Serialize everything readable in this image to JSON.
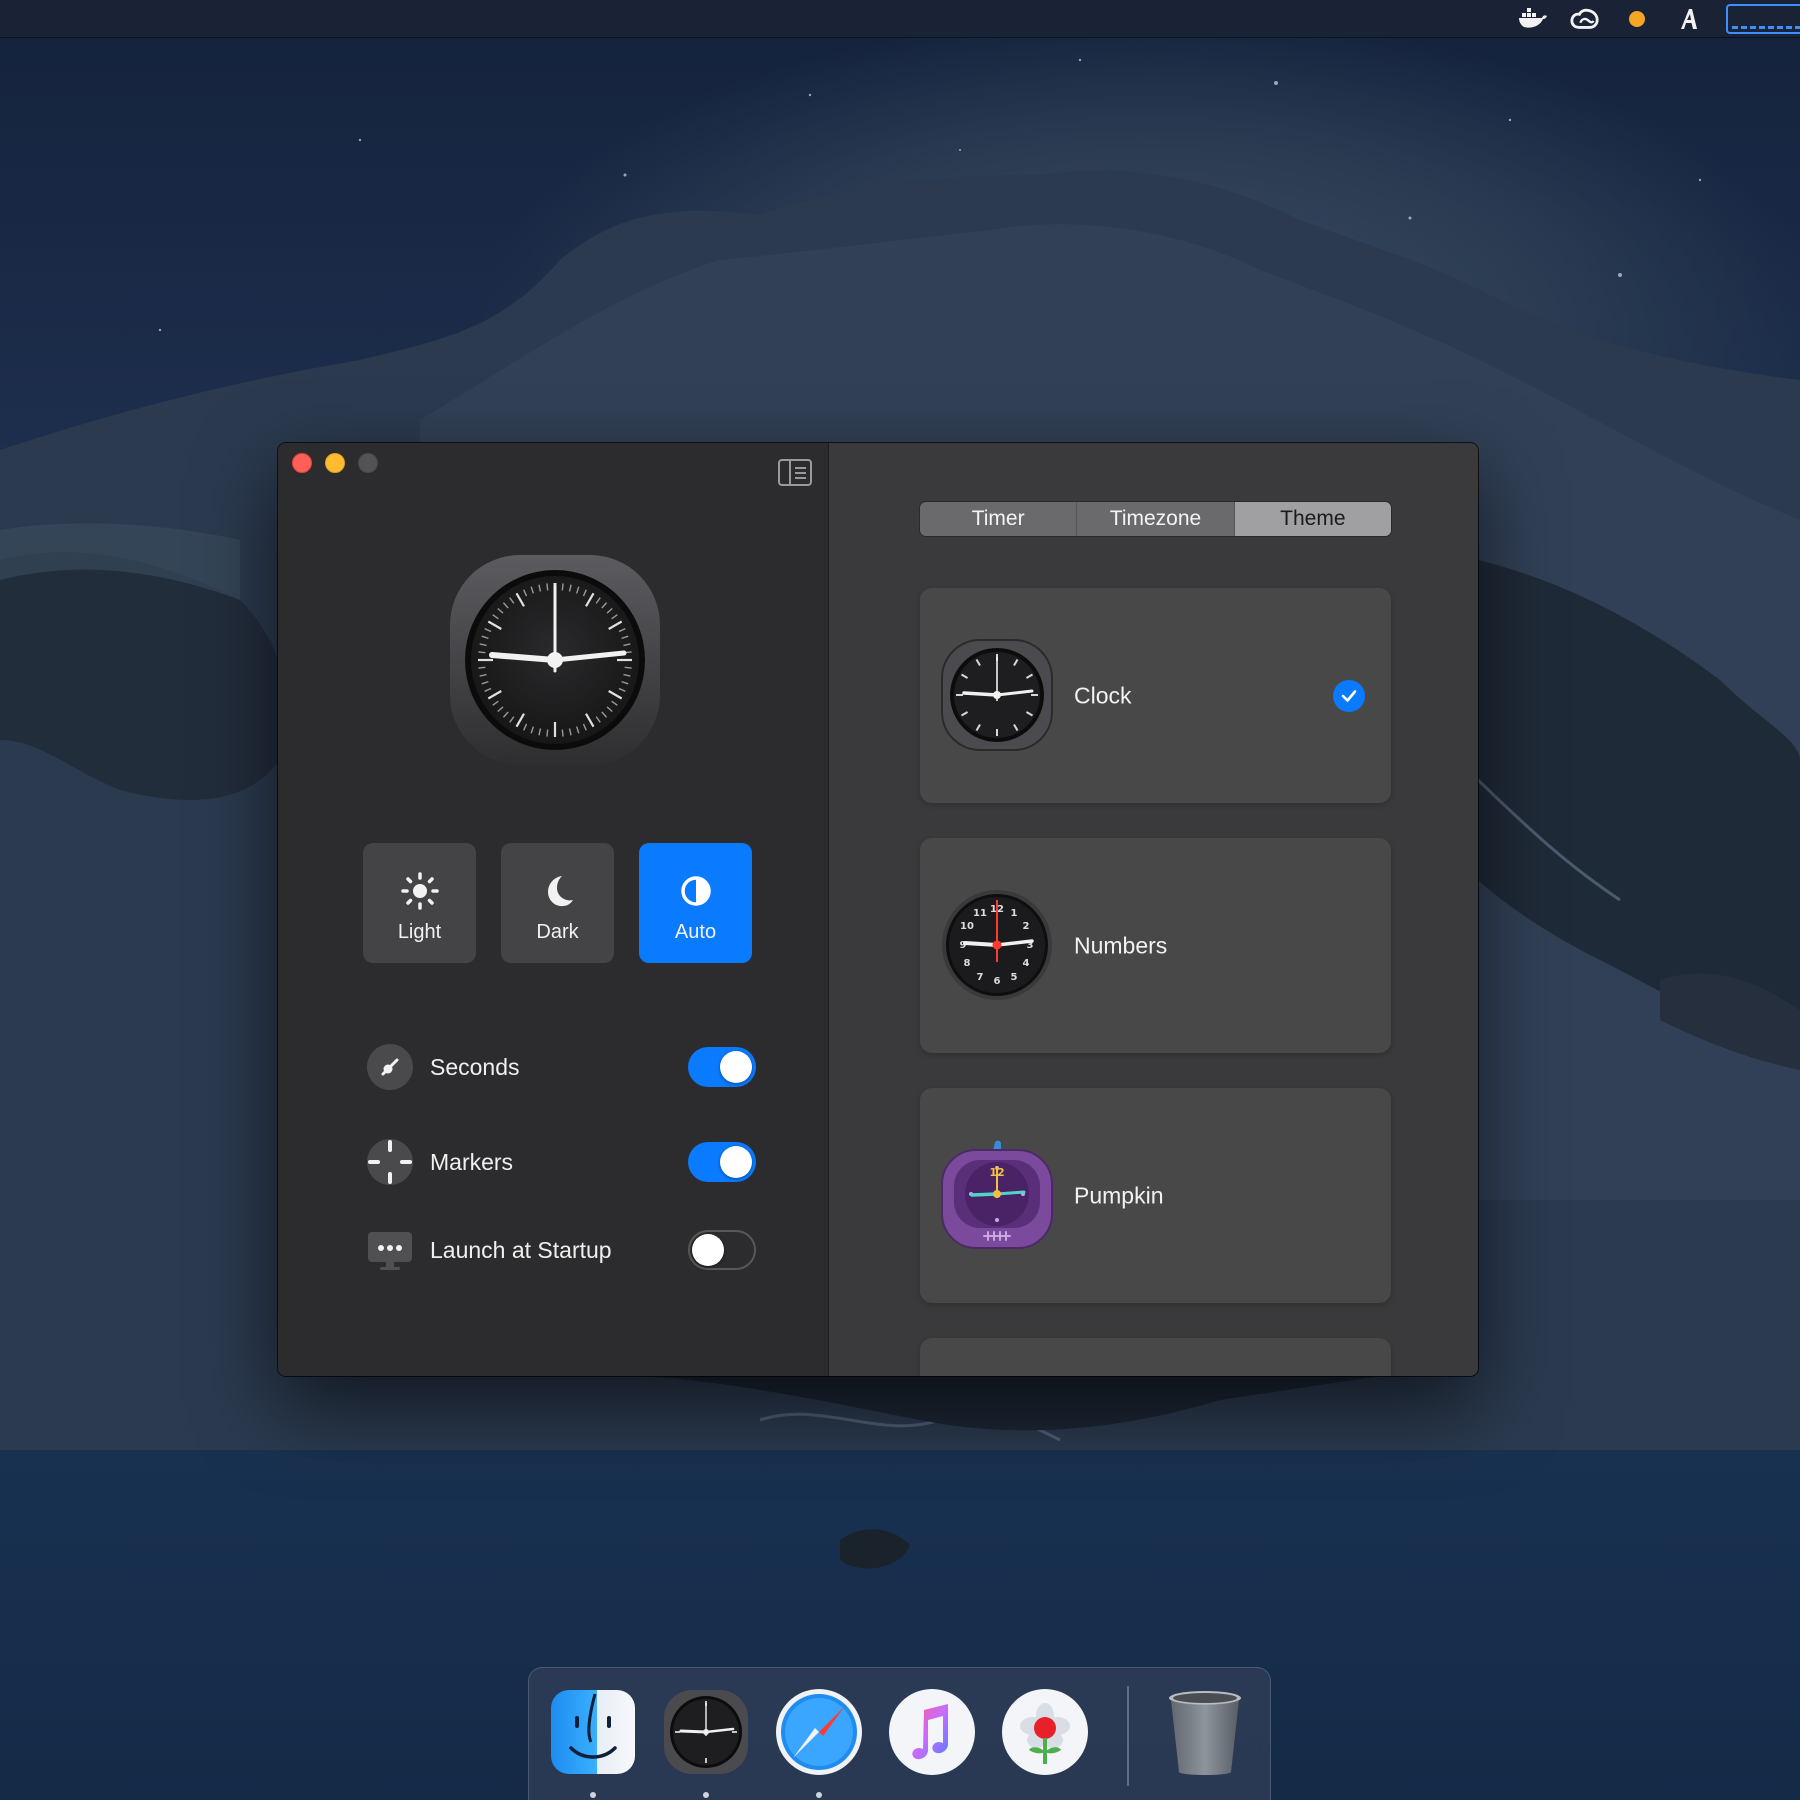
{
  "window": {
    "tabs": [
      {
        "label": "Timer",
        "active": false
      },
      {
        "label": "Timezone",
        "active": false
      },
      {
        "label": "Theme",
        "active": true
      }
    ]
  },
  "appearance": {
    "options": [
      {
        "label": "Light",
        "icon": "sun-icon",
        "selected": false
      },
      {
        "label": "Dark",
        "icon": "moon-icon",
        "selected": false
      },
      {
        "label": "Auto",
        "icon": "auto-contrast-icon",
        "selected": true
      }
    ],
    "accent_color": "#0a7aff"
  },
  "settings": [
    {
      "label": "Seconds",
      "icon": "seconds-hand-icon",
      "enabled": true
    },
    {
      "label": "Markers",
      "icon": "markers-icon",
      "enabled": true
    },
    {
      "label": "Launch at Startup",
      "icon": "startup-display-icon",
      "enabled": false
    }
  ],
  "themes": [
    {
      "name": "Clock",
      "icon": "classic-clock-icon",
      "selected": true
    },
    {
      "name": "Numbers",
      "icon": "numbers-clock-icon",
      "selected": false
    },
    {
      "name": "Pumpkin",
      "icon": "pumpkin-clock-icon",
      "selected": false
    }
  ],
  "dock": [
    {
      "name": "finder-icon",
      "running": true
    },
    {
      "name": "clock-app-icon",
      "running": true
    },
    {
      "name": "safari-icon",
      "running": true
    },
    {
      "name": "music-icon",
      "running": false
    },
    {
      "name": "photos-icon",
      "running": false
    },
    {
      "name": "trash-icon",
      "running": false
    }
  ],
  "menubar_icons": [
    "docker-icon",
    "creative-cloud-icon",
    "status-dot-icon",
    "font-a-icon",
    "status-meter-icon"
  ]
}
